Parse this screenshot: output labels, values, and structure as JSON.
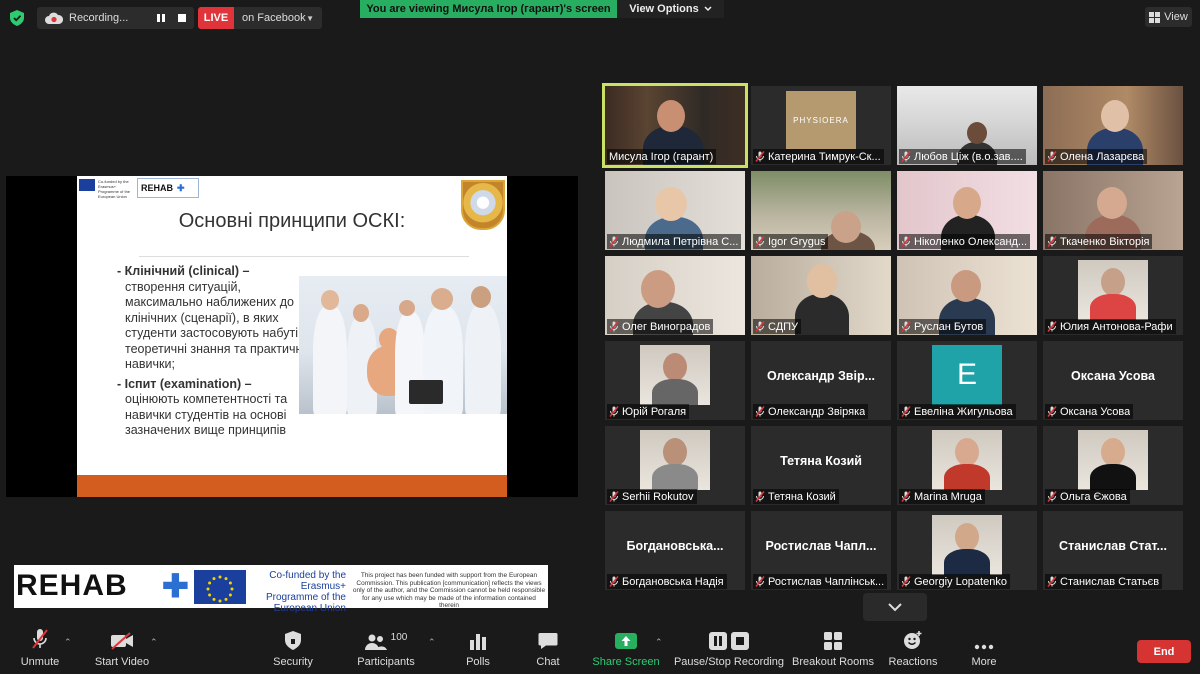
{
  "topbar": {
    "recording_label": "Recording...",
    "live_badge": "LIVE",
    "live_destination": "on Facebook",
    "viewing_banner": "You are viewing Мисула Ігор (гарант)'s screen",
    "view_options": "View Options",
    "view_button": "View"
  },
  "slide": {
    "cofund_small": "Co-funded by the Erasmus+ Programme of the European Union",
    "rehab_small": "REHAB",
    "title": "Основні принципи ОСКІ:",
    "bullet1_head": "- Клінічний (clinical) –",
    "bullet1_body": "створення ситуацій, максимально наближених до клінічних (сценарії), в яких студенти застосовують набуті теоретичні знання та практичні навички;",
    "bullet2_head": "- Іспит (examination) –",
    "bullet2_body": "оцінюють компетентності та навички студентів на основі зазначених вище принципів"
  },
  "banner": {
    "rehab": "REHAB",
    "eu_text": "Co-funded by the Erasmus+ Programme of the European Union",
    "disclaimer": "This project has been funded with support from the European Commission. This publication [communication] reflects the views only of the author, and the Commission cannot be held responsible for any use which may be made of the information contained therein"
  },
  "participants": [
    {
      "name": "Мисула Ігор (гарант)",
      "muted": false
    },
    {
      "name": "Катерина Тимрук-Ск...",
      "muted": true
    },
    {
      "name": "Любов Цiж (в.о.зав....",
      "muted": true
    },
    {
      "name": "Олена Лазарєва",
      "muted": true
    },
    {
      "name": "Людмила Петрівна С...",
      "muted": true
    },
    {
      "name": "Igor Grygus",
      "muted": true
    },
    {
      "name": "Ніколенко Олександ...",
      "muted": true
    },
    {
      "name": "Ткаченко Вікторія",
      "muted": true
    },
    {
      "name": "Олег Виноградов",
      "muted": true
    },
    {
      "name": "СДПУ",
      "muted": true
    },
    {
      "name": "Руслан Бутов",
      "muted": true
    },
    {
      "name": "Юлия Антонова-Рафи",
      "muted": true
    },
    {
      "name": "Юрій Рогаля",
      "muted": true
    },
    {
      "name": "Олександр Звіряка",
      "muted": true,
      "big": "Олександр Звір..."
    },
    {
      "name": "Евеліна Жигульова",
      "muted": true,
      "avatar_letter": "E"
    },
    {
      "name": "Оксана Усова",
      "muted": true,
      "big": "Оксана Усова"
    },
    {
      "name": "Serhii Rokutov",
      "muted": true
    },
    {
      "name": "Тетяна Козий",
      "muted": true,
      "big": "Тетяна Козий"
    },
    {
      "name": "Marina Mruga",
      "muted": true
    },
    {
      "name": "Ольга Єжова",
      "muted": true
    },
    {
      "name": "Богдановська Надія",
      "muted": true,
      "big": "Богдановська..."
    },
    {
      "name": "Ростислав Чаплінськ...",
      "muted": true,
      "big": "Ростислав Чапл..."
    },
    {
      "name": "Georgiy Lopatenko",
      "muted": true
    },
    {
      "name": "Станислав Статьєв",
      "muted": true,
      "big": "Станислав Стат..."
    }
  ],
  "tile_extra": {
    "physio_text": "PHYSIOERA"
  },
  "toolbar": {
    "unmute": "Unmute",
    "start_video": "Start Video",
    "security": "Security",
    "participants": "Participants",
    "participants_count": "100",
    "polls": "Polls",
    "chat": "Chat",
    "share_screen": "Share Screen",
    "pause_recording": "Pause/Stop Recording",
    "breakout": "Breakout Rooms",
    "reactions": "Reactions",
    "more": "More",
    "end": "End"
  },
  "colors": {
    "accent_green": "#27ae60",
    "live_red": "#e0343a",
    "speaker_outline": "#c9e265",
    "end_red": "#d63333",
    "mute_red": "#e0343a"
  }
}
